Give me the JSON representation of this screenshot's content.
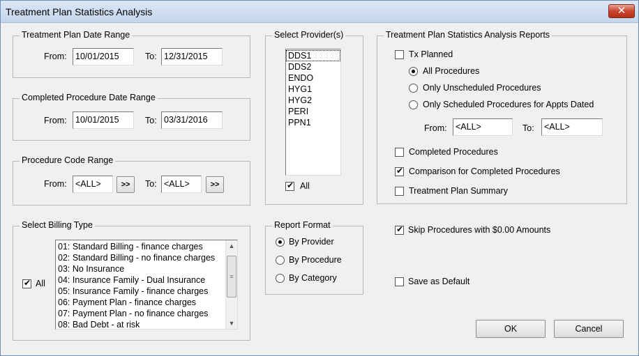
{
  "window": {
    "title": "Treatment Plan Statistics Analysis",
    "close_glyph": "✕"
  },
  "tp_range": {
    "label": "Treatment Plan Date Range",
    "from_label": "From:",
    "from_value": "10/01/2015",
    "to_label": "To:",
    "to_value": "12/31/2015"
  },
  "cp_range": {
    "label": "Completed Procedure Date Range",
    "from_label": "From:",
    "from_value": "10/01/2015",
    "to_label": "To:",
    "to_value": "03/31/2016"
  },
  "code_range": {
    "label": "Procedure Code Range",
    "from_label": "From:",
    "from_value": "<ALL>",
    "to_label": "To:",
    "to_value": "<ALL>",
    "browse_label": ">>"
  },
  "billing": {
    "label": "Select Billing Type",
    "all_label": "All",
    "all_checked": true,
    "items": [
      "01: Standard Billing - finance charges",
      "02: Standard Billing - no finance charges",
      "03: No Insurance",
      "04: Insurance Family - Dual Insurance",
      "05: Insurance Family - finance charges",
      "06: Payment Plan - finance charges",
      "07: Payment Plan - no finance charges",
      "08: Bad Debt - at risk"
    ]
  },
  "providers": {
    "label": "Select Provider(s)",
    "items": [
      "DDS1",
      "DDS2",
      "ENDO",
      "HYG1",
      "HYG2",
      "PERI",
      "PPN1"
    ],
    "all_label": "All",
    "all_checked": true
  },
  "format": {
    "label": "Report Format",
    "options": [
      "By Provider",
      "By Procedure",
      "By Category"
    ],
    "selected": "By Provider"
  },
  "reports": {
    "label": "Treatment Plan Statistics Analysis Reports",
    "tx_planned": "Tx Planned",
    "all_procedures": "All Procedures",
    "only_unscheduled": "Only Unscheduled Procedures",
    "only_scheduled": "Only Scheduled Procedures for Appts Dated",
    "from_label": "From:",
    "from_value": "<ALL>",
    "to_label": "To:",
    "to_value": "<ALL>",
    "completed": "Completed Procedures",
    "comparison": "Comparison for Completed Procedures",
    "summary": "Treatment Plan Summary"
  },
  "options": {
    "skip_zero": "Skip Procedures with $0.00 Amounts",
    "save_default": "Save as Default"
  },
  "buttons": {
    "ok": "OK",
    "cancel": "Cancel"
  },
  "scroll_glyphs": {
    "up": "▲",
    "down": "▼",
    "grip": "≡"
  }
}
